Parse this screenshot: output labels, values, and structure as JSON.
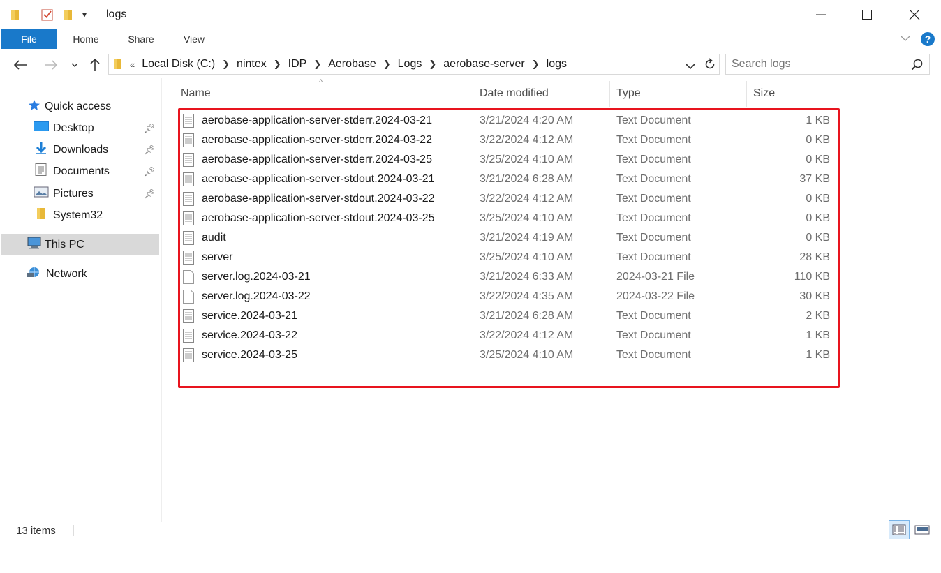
{
  "window": {
    "title": "logs"
  },
  "ribbon": {
    "tabs": [
      {
        "label": "File"
      },
      {
        "label": "Home"
      },
      {
        "label": "Share"
      },
      {
        "label": "View"
      }
    ],
    "help_glyph": "?"
  },
  "navigation": {
    "address_overflow": "«",
    "breadcrumbs": [
      "Local Disk (C:)",
      "nintex",
      "IDP",
      "Aerobase",
      "Logs",
      "aerobase-server",
      "logs"
    ],
    "search": {
      "placeholder": "Search logs"
    }
  },
  "sidebar": {
    "items": [
      {
        "label": "Quick access",
        "icon": "star-icon",
        "pinned": false
      },
      {
        "label": "Desktop",
        "icon": "desktop-icon",
        "pinned": true
      },
      {
        "label": "Downloads",
        "icon": "download-icon",
        "pinned": true
      },
      {
        "label": "Documents",
        "icon": "documents-icon",
        "pinned": true
      },
      {
        "label": "Pictures",
        "icon": "pictures-icon",
        "pinned": true
      },
      {
        "label": "System32",
        "icon": "folder-icon",
        "pinned": false
      },
      {
        "label": "This PC",
        "icon": "computer-icon",
        "pinned": false,
        "selected": true
      },
      {
        "label": "Network",
        "icon": "network-icon",
        "pinned": false
      }
    ]
  },
  "file_list": {
    "columns": [
      "Name",
      "Date modified",
      "Type",
      "Size"
    ],
    "sort_column": "Name",
    "rows": [
      {
        "name": "aerobase-application-server-stderr.2024-03-21",
        "date": "3/21/2024 4:20 AM",
        "type": "Text Document",
        "size": "1 KB",
        "icon": "text-file-icon"
      },
      {
        "name": "aerobase-application-server-stderr.2024-03-22",
        "date": "3/22/2024 4:12 AM",
        "type": "Text Document",
        "size": "0 KB",
        "icon": "text-file-icon"
      },
      {
        "name": "aerobase-application-server-stderr.2024-03-25",
        "date": "3/25/2024 4:10 AM",
        "type": "Text Document",
        "size": "0 KB",
        "icon": "text-file-icon"
      },
      {
        "name": "aerobase-application-server-stdout.2024-03-21",
        "date": "3/21/2024 6:28 AM",
        "type": "Text Document",
        "size": "37 KB",
        "icon": "text-file-icon"
      },
      {
        "name": "aerobase-application-server-stdout.2024-03-22",
        "date": "3/22/2024 4:12 AM",
        "type": "Text Document",
        "size": "0 KB",
        "icon": "text-file-icon"
      },
      {
        "name": "aerobase-application-server-stdout.2024-03-25",
        "date": "3/25/2024 4:10 AM",
        "type": "Text Document",
        "size": "0 KB",
        "icon": "text-file-icon"
      },
      {
        "name": "audit",
        "date": "3/21/2024 4:19 AM",
        "type": "Text Document",
        "size": "0 KB",
        "icon": "text-file-icon"
      },
      {
        "name": "server",
        "date": "3/25/2024 4:10 AM",
        "type": "Text Document",
        "size": "28 KB",
        "icon": "text-file-icon"
      },
      {
        "name": "server.log.2024-03-21",
        "date": "3/21/2024 6:33 AM",
        "type": "2024-03-21 File",
        "size": "110 KB",
        "icon": "blank-file-icon"
      },
      {
        "name": "server.log.2024-03-22",
        "date": "3/22/2024 4:35 AM",
        "type": "2024-03-22 File",
        "size": "30 KB",
        "icon": "blank-file-icon"
      },
      {
        "name": "service.2024-03-21",
        "date": "3/21/2024 6:28 AM",
        "type": "Text Document",
        "size": "2 KB",
        "icon": "text-file-icon"
      },
      {
        "name": "service.2024-03-22",
        "date": "3/22/2024 4:12 AM",
        "type": "Text Document",
        "size": "1 KB",
        "icon": "text-file-icon"
      },
      {
        "name": "service.2024-03-25",
        "date": "3/25/2024 4:10 AM",
        "type": "Text Document",
        "size": "1 KB",
        "icon": "text-file-icon"
      }
    ]
  },
  "status_bar": {
    "item_count": "13 items"
  },
  "colors": {
    "accent": "#1979ca",
    "highlight_box": "#e8141e",
    "selected_bg": "#d9d9d9"
  }
}
